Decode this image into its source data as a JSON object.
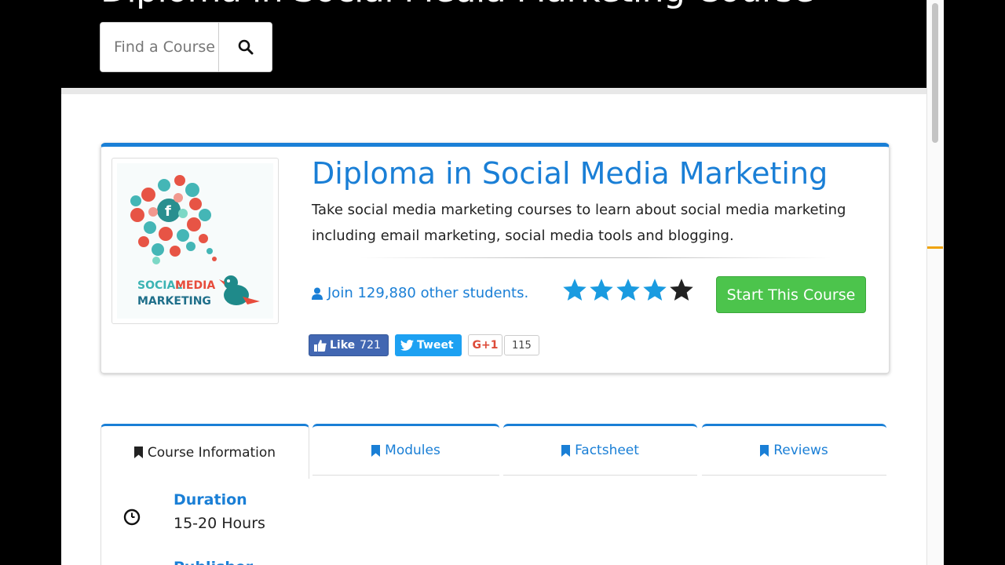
{
  "hero": {
    "title": "Diploma in Social Media Marketing Course",
    "search_placeholder": "Find a Course"
  },
  "course": {
    "title": "Diploma in Social Media Marketing",
    "description": "Take social media marketing courses to learn about social media marketing including email marketing, social media tools and blogging.",
    "join_text": "Join 129,880 other students.",
    "rating": 4,
    "rating_max": 5,
    "start_label": "Start This Course",
    "thumb_line1_a": "SOCIAL",
    "thumb_line1_b": "MEDIA",
    "thumb_line2": "MARKETING"
  },
  "social": {
    "fb_label": "Like",
    "fb_count": "721",
    "tweet_label": "Tweet",
    "gplus_label": "G+1",
    "gplus_count": "115"
  },
  "tabs": [
    {
      "label": "Course Information"
    },
    {
      "label": "Modules"
    },
    {
      "label": "Factsheet"
    },
    {
      "label": "Reviews"
    }
  ],
  "info": {
    "duration_label": "Duration",
    "duration_value": "15-20 Hours",
    "publisher_label": "Publisher"
  },
  "colors": {
    "accent": "#1a7fd6",
    "start_button": "#4cc44c",
    "facebook": "#4267b2",
    "twitter": "#1da1f2",
    "gplus": "#dd4b39"
  }
}
